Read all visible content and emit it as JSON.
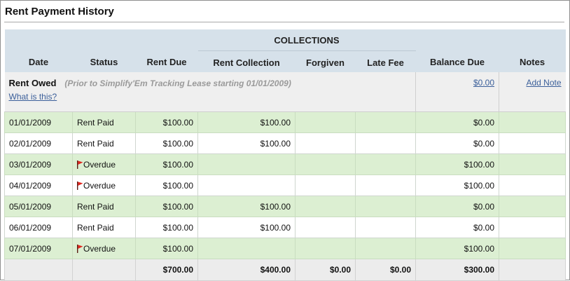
{
  "page": {
    "title": "Rent Payment History"
  },
  "table": {
    "group_header": "COLLECTIONS",
    "columns": {
      "date": "Date",
      "status": "Status",
      "rent_due": "Rent Due",
      "rent_collection": "Rent Collection",
      "forgiven": "Forgiven",
      "late_fee": "Late Fee",
      "balance_due": "Balance Due",
      "notes": "Notes"
    },
    "rent_owed": {
      "label": "Rent Owed",
      "help_link": "What is this?",
      "note": "(Prior to Simplify'Em Tracking Lease starting 01/01/2009)",
      "balance": "$0.00",
      "add_note": "Add Note"
    },
    "rows": [
      {
        "date": "01/01/2009",
        "status": "Rent Paid",
        "flag": false,
        "rent_due": "$100.00",
        "rent_collection": "$100.00",
        "forgiven": "",
        "late_fee": "",
        "balance_due": "$0.00",
        "notes": ""
      },
      {
        "date": "02/01/2009",
        "status": "Rent Paid",
        "flag": false,
        "rent_due": "$100.00",
        "rent_collection": "$100.00",
        "forgiven": "",
        "late_fee": "",
        "balance_due": "$0.00",
        "notes": ""
      },
      {
        "date": "03/01/2009",
        "status": "Overdue",
        "flag": true,
        "rent_due": "$100.00",
        "rent_collection": "",
        "forgiven": "",
        "late_fee": "",
        "balance_due": "$100.00",
        "notes": ""
      },
      {
        "date": "04/01/2009",
        "status": "Overdue",
        "flag": true,
        "rent_due": "$100.00",
        "rent_collection": "",
        "forgiven": "",
        "late_fee": "",
        "balance_due": "$100.00",
        "notes": ""
      },
      {
        "date": "05/01/2009",
        "status": "Rent Paid",
        "flag": false,
        "rent_due": "$100.00",
        "rent_collection": "$100.00",
        "forgiven": "",
        "late_fee": "",
        "balance_due": "$0.00",
        "notes": ""
      },
      {
        "date": "06/01/2009",
        "status": "Rent Paid",
        "flag": false,
        "rent_due": "$100.00",
        "rent_collection": "$100.00",
        "forgiven": "",
        "late_fee": "",
        "balance_due": "$0.00",
        "notes": ""
      },
      {
        "date": "07/01/2009",
        "status": "Overdue",
        "flag": true,
        "rent_due": "$100.00",
        "rent_collection": "",
        "forgiven": "",
        "late_fee": "",
        "balance_due": "$100.00",
        "notes": ""
      }
    ],
    "totals": {
      "rent_due": "$700.00",
      "rent_collection": "$400.00",
      "forgiven": "$0.00",
      "late_fee": "$0.00",
      "balance_due": "$300.00"
    }
  },
  "colors": {
    "header_bg": "#d6e1ea",
    "row_green": "#dcefd2",
    "row_white": "#ffffff",
    "flag_red": "#e0261d",
    "link": "#3b5f9a"
  },
  "icons": {
    "overdue_flag": "red-flag-icon"
  }
}
